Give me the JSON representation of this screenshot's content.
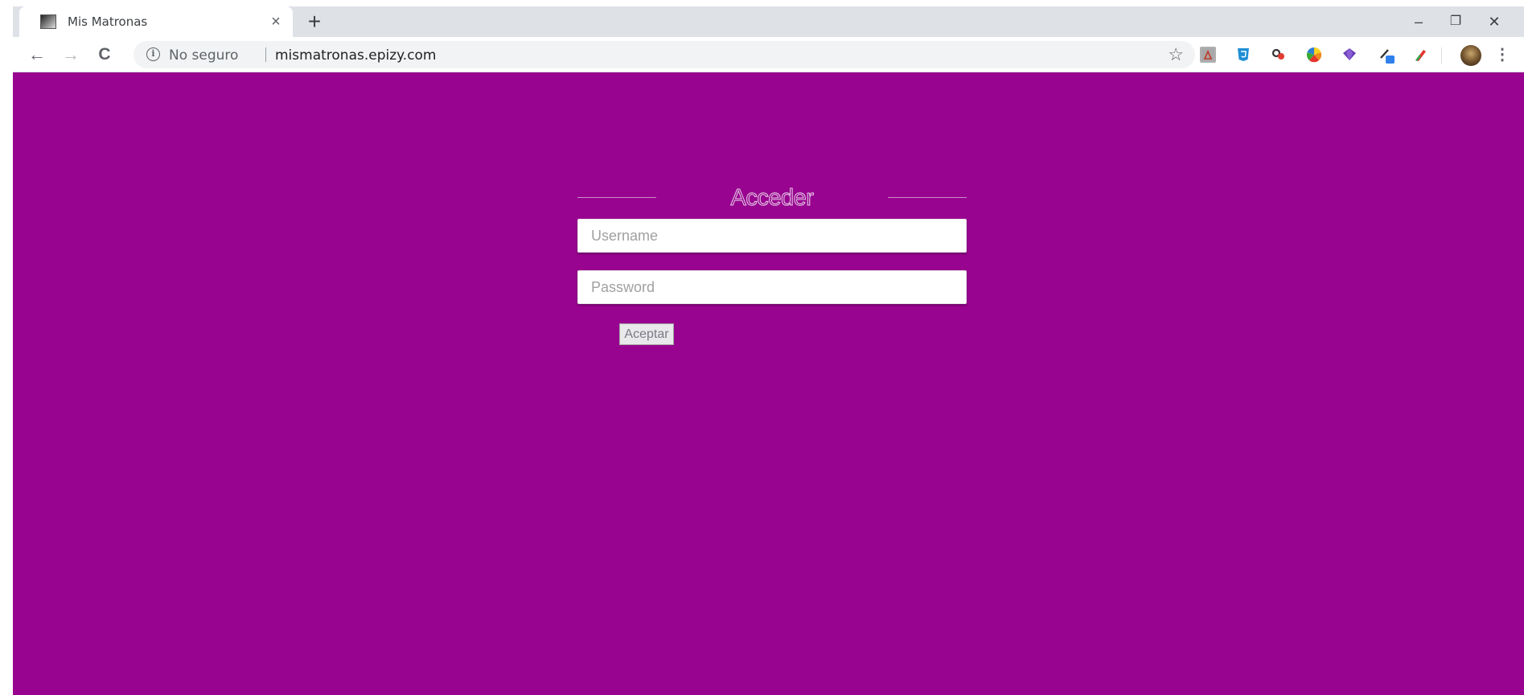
{
  "browser": {
    "tab": {
      "title": "Mis Matronas",
      "close_glyph": "×"
    },
    "new_tab_glyph": "+",
    "window_controls": {
      "minimize_glyph": "–",
      "restore_glyph": "❐",
      "close_glyph": "✕"
    },
    "toolbar": {
      "back_glyph": "←",
      "forward_glyph": "→",
      "reload_glyph": "C",
      "info_glyph": "i",
      "security_text": "No seguro",
      "url": "mismatronas.epizy.com",
      "star_glyph": "☆",
      "menu_glyph": "⋮",
      "extensions": [
        "pdf-extension-icon",
        "css3-extension-icon",
        "color-extension-icon",
        "color-wheel-extension-icon",
        "gem-extension-icon",
        "eyedropper-extension-icon",
        "brush-extension-icon"
      ]
    }
  },
  "page": {
    "background": "#98048f",
    "login": {
      "title": "Acceder",
      "username_placeholder": "Username",
      "password_placeholder": "Password",
      "submit_label": "Aceptar"
    }
  }
}
